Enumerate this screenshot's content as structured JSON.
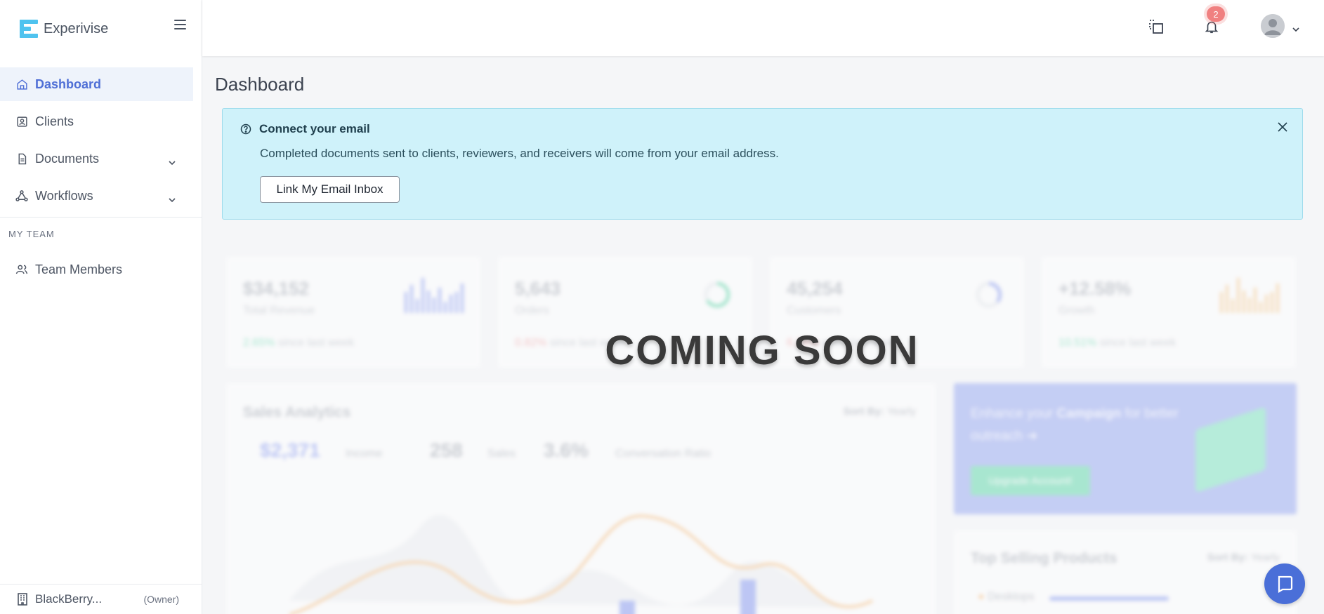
{
  "brand": {
    "name": "Experivise"
  },
  "sidebar": {
    "items": [
      {
        "label": "Dashboard",
        "icon": "home-icon",
        "active": true
      },
      {
        "label": "Clients",
        "icon": "contact-icon"
      },
      {
        "label": "Documents",
        "icon": "document-icon",
        "expandable": true
      },
      {
        "label": "Workflows",
        "icon": "workflow-icon",
        "expandable": true
      }
    ],
    "section_title": "MY TEAM",
    "team_item": {
      "label": "Team Members",
      "icon": "users-icon"
    },
    "footer": {
      "org": "BlackBerry...",
      "role": "(Owner)"
    }
  },
  "topbar": {
    "notification_count": "2"
  },
  "page": {
    "title": "Dashboard"
  },
  "alert": {
    "title": "Connect your email",
    "text": "Completed documents sent to clients, reviewers, and receivers will come from your email address.",
    "button": "Link My Email Inbox"
  },
  "overlay": {
    "text": "COMING SOON"
  },
  "background": {
    "stats": [
      {
        "value": "$34,152",
        "label": "Total Revenue",
        "trend": "2.65%",
        "dir": "up",
        "suffix": "since last week"
      },
      {
        "value": "5,643",
        "label": "Orders",
        "trend": "0.82%",
        "dir": "down",
        "suffix": "since last week"
      },
      {
        "value": "45,254",
        "label": "Customers",
        "trend": "6.24%",
        "dir": "down",
        "suffix": "since last week"
      },
      {
        "value": "+12.58%",
        "label": "Growth",
        "trend": "10.51%",
        "dir": "up",
        "suffix": "since last week"
      }
    ],
    "sales": {
      "title": "Sales Analytics",
      "sort_label": "Sort By:",
      "sort_value": "Yearly",
      "income": "$2,371",
      "income_label": "Income",
      "sales": "258",
      "sales_label": "Sales",
      "ratio": "3.6%",
      "ratio_label": "Conversation Ratio"
    },
    "promo": {
      "text_a": "Enhance your ",
      "text_b": "Campaign",
      "text_c": " for better outreach",
      "button": "Upgrade Account!"
    },
    "top_selling": {
      "title": "Top Selling Products",
      "sort_label": "Sort By:",
      "sort_value": "Yearly",
      "item": "Desktops"
    }
  },
  "colors": {
    "accent": "#4f6fd6",
    "alert_bg": "#cff2fa",
    "badge": "#f08080",
    "chat": "#4a6fd8"
  }
}
